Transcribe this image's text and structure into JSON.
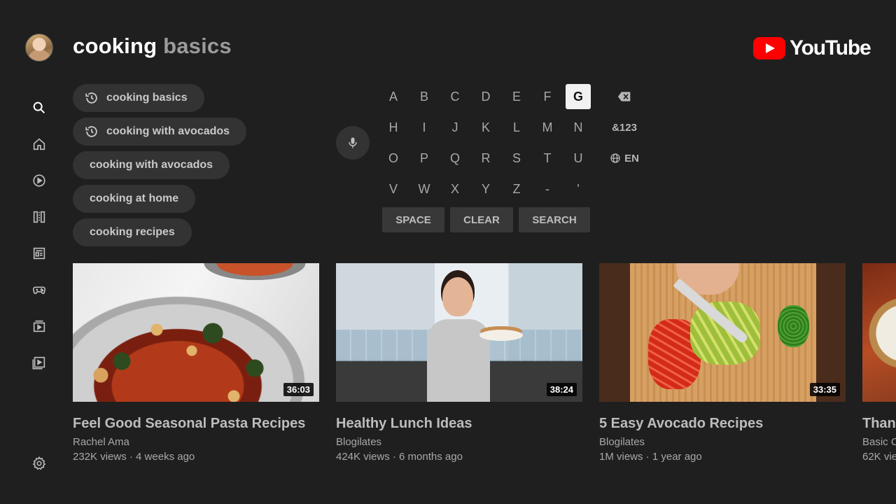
{
  "search": {
    "query_typed": "cooking ",
    "query_suggested": "basics"
  },
  "brand": {
    "name": "YouTube",
    "accent_color": "#ff0000"
  },
  "sidebar": {
    "items": [
      {
        "id": "search",
        "icon": "search-icon"
      },
      {
        "id": "home",
        "icon": "home-icon"
      },
      {
        "id": "shorts",
        "icon": "play-circle-icon"
      },
      {
        "id": "subscriptions",
        "icon": "subscriptions-icon"
      },
      {
        "id": "news",
        "icon": "news-icon"
      },
      {
        "id": "gaming",
        "icon": "gamepad-icon"
      },
      {
        "id": "library",
        "icon": "library-icon"
      },
      {
        "id": "playlists",
        "icon": "playlist-play-icon"
      }
    ],
    "settings_icon": "gear-icon"
  },
  "suggestions": [
    {
      "label": "cooking basics",
      "history": true
    },
    {
      "label": "cooking with avocados",
      "history": true
    },
    {
      "label": "cooking with avocados",
      "history": false
    },
    {
      "label": "cooking at home",
      "history": false
    },
    {
      "label": "cooking recipes",
      "history": false
    }
  ],
  "keyboard": {
    "rows": [
      [
        "A",
        "B",
        "C",
        "D",
        "E",
        "F",
        "G"
      ],
      [
        "H",
        "I",
        "J",
        "K",
        "L",
        "M",
        "N"
      ],
      [
        "O",
        "P",
        "Q",
        "R",
        "S",
        "T",
        "U"
      ],
      [
        "V",
        "W",
        "X",
        "Y",
        "Z",
        "-",
        "'"
      ]
    ],
    "focused_key": "G",
    "symbols_label": "&123",
    "language_label": "EN",
    "space_label": "SPACE",
    "clear_label": "CLEAR",
    "search_label": "SEARCH"
  },
  "videos": [
    {
      "title": "Feel Good Seasonal Pasta Recipes",
      "channel": "Rachel Ama",
      "meta": "232K views · 4 weeks ago",
      "duration": "36:03"
    },
    {
      "title": "Healthy Lunch Ideas",
      "channel": "Blogilates",
      "meta": "424K views · 6 months ago",
      "duration": "38:24"
    },
    {
      "title": "5 Easy Avocado Recipes",
      "channel": "Blogilates",
      "meta": "1M views · 1 year ago",
      "duration": "33:35"
    },
    {
      "title": "Than",
      "channel": "Basic C",
      "meta": "62K vie",
      "duration": ""
    }
  ]
}
